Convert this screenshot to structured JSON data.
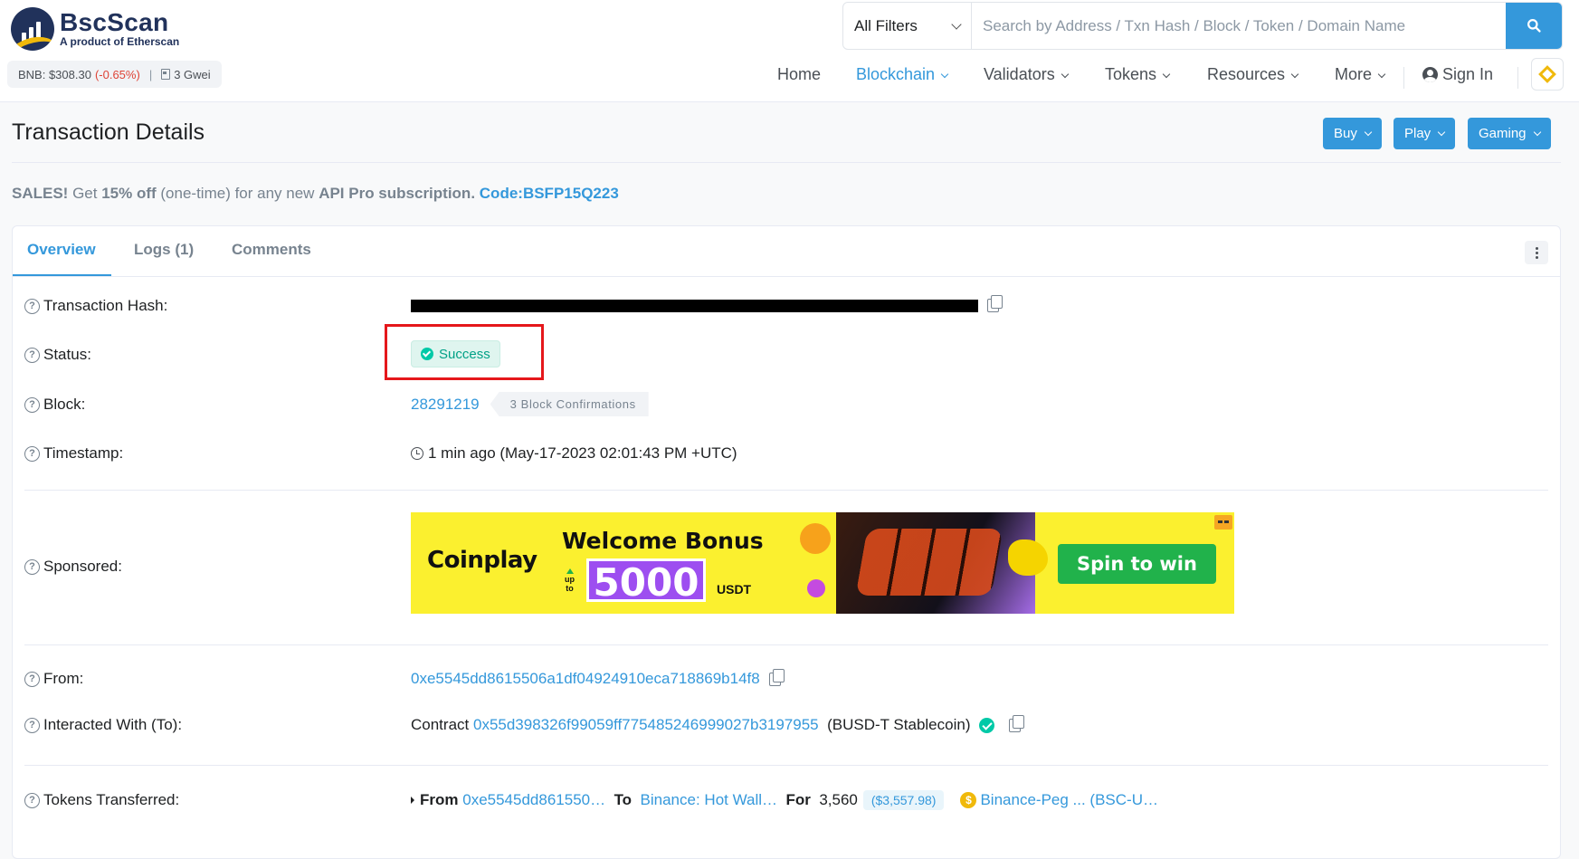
{
  "header": {
    "logo_name": "BscScan",
    "logo_sub": "A product of Etherscan",
    "price_label": "BNB: $308.30",
    "price_change": "(-0.65%)",
    "separator": "|",
    "gas": "3 Gwei",
    "filter_label": "All Filters",
    "search_placeholder": "Search by Address / Txn Hash / Block / Token / Domain Name",
    "nav": {
      "home": "Home",
      "blockchain": "Blockchain",
      "validators": "Validators",
      "tokens": "Tokens",
      "resources": "Resources",
      "more": "More",
      "signin": "Sign In"
    }
  },
  "page": {
    "title": "Transaction Details",
    "buttons": {
      "buy": "Buy",
      "play": "Play",
      "gaming": "Gaming"
    },
    "sales": {
      "lead": "SALES!",
      "t1": " Get ",
      "off": "15% off",
      "t2": " (one-time) for any new ",
      "product": "API Pro subscription.",
      "code": "Code:BSFP15Q223"
    }
  },
  "tabs": {
    "overview": "Overview",
    "logs": "Logs (1)",
    "comments": "Comments"
  },
  "details": {
    "labels": {
      "hash": "Transaction Hash:",
      "status": "Status:",
      "block": "Block:",
      "timestamp": "Timestamp:",
      "sponsored": "Sponsored:",
      "from": "From:",
      "to": "Interacted With (To):",
      "tokens": "Tokens Transferred:"
    },
    "status": "Success",
    "block_number": "28291219",
    "confirmations": "3 Block Confirmations",
    "timestamp": "1 min ago (May-17-2023 02:01:43 PM +UTC)",
    "from_address": "0xe5545dd8615506a1df04924910eca718869b14f8",
    "to_prefix": "Contract",
    "to_address": "0x55d398326f99059ff775485246999027b3197955",
    "to_name": "(BUSD-T Stablecoin)",
    "transfer": {
      "from_label": "From",
      "from_addr": "0xe5545dd861550…",
      "to_label": "To",
      "to_addr": "Binance: Hot Wall…",
      "for_label": "For",
      "amount": "3,560",
      "usd": "($3,557.98)",
      "token": "Binance-Peg ... (BSC-U…"
    }
  },
  "banner": {
    "brand": "Coinplay",
    "headline": "Welcome Bonus",
    "upto_top": "up",
    "upto_bottom": "to",
    "amount": "5000",
    "unit": "USDT",
    "cta": "Spin to win"
  },
  "colors": {
    "accent": "#3498db",
    "success": "#00c9a7",
    "negative": "#de4437",
    "banner_bg": "#fbf02f",
    "highlight_frame": "#e5171b"
  }
}
